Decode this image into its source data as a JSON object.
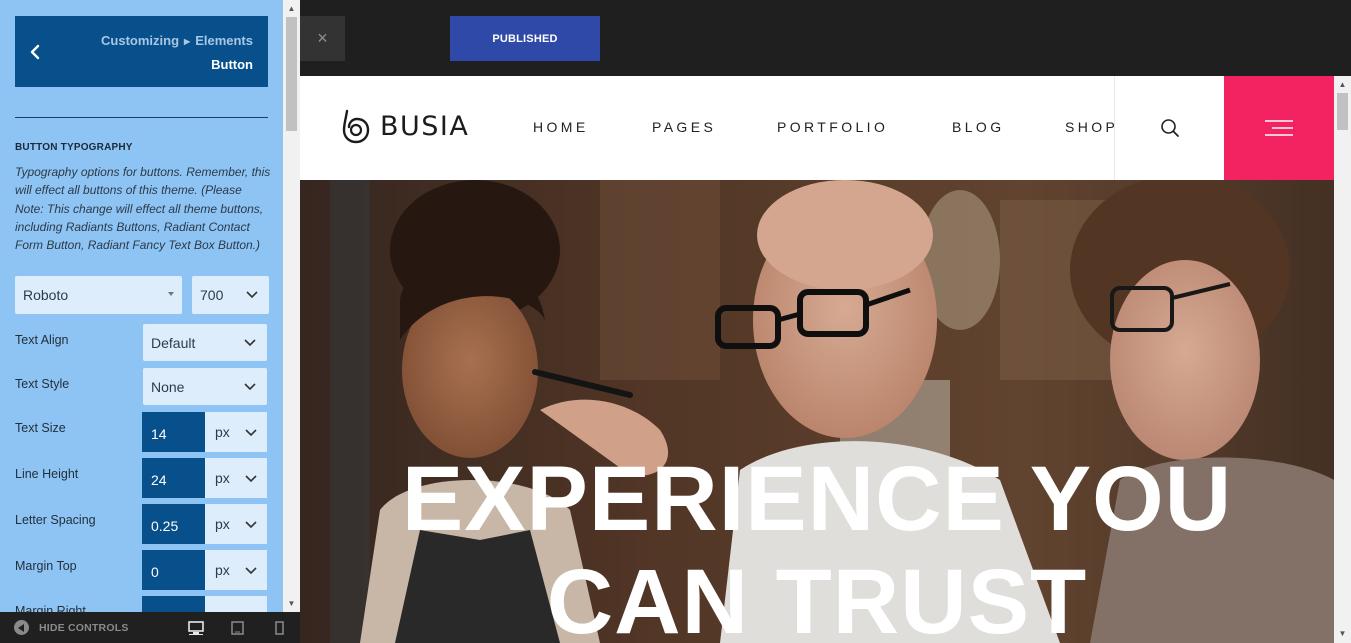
{
  "customizer": {
    "breadcrumb": {
      "path": [
        "Customizing",
        "Elements"
      ],
      "title": "Button"
    },
    "section": {
      "title": "BUTTON TYPOGRAPHY",
      "description": "Typography options for buttons. Remember, this will effect all buttons of this theme. (Please Note: This change will effect all theme buttons, including Radiants Buttons, Radiant Contact Form Button, Radiant Fancy Text Box Button.)"
    },
    "font_family": "Roboto",
    "font_weight": "700",
    "controls": {
      "text_align": {
        "label": "Text Align",
        "value": "Default"
      },
      "text_style": {
        "label": "Text Style",
        "value": "None"
      },
      "text_size": {
        "label": "Text Size",
        "value": "14",
        "unit": "px"
      },
      "line_height": {
        "label": "Line Height",
        "value": "24",
        "unit": "px"
      },
      "letter_spacing": {
        "label": "Letter Spacing",
        "value": "0.25",
        "unit": "px"
      },
      "margin_top": {
        "label": "Margin Top",
        "value": "0",
        "unit": "px"
      },
      "margin_right": {
        "label": "Margin Right"
      }
    },
    "footer": {
      "hide_controls": "HIDE CONTROLS",
      "devices": [
        "desktop-icon",
        "tablet-icon",
        "mobile-icon"
      ]
    }
  },
  "topbar": {
    "close": "×",
    "publish": "PUBLISHED"
  },
  "site": {
    "logo": "BUSIA",
    "nav": [
      "HOME",
      "PAGES",
      "PORTFOLIO",
      "BLOG",
      "SHOP"
    ],
    "hero_title": [
      "EXPERIENCE YOU",
      "CAN TRUST"
    ],
    "colors": {
      "accent": "#f22360",
      "sidebar": "#8ec4f3",
      "primary": "#07508c",
      "publish": "#2f49a8"
    }
  }
}
